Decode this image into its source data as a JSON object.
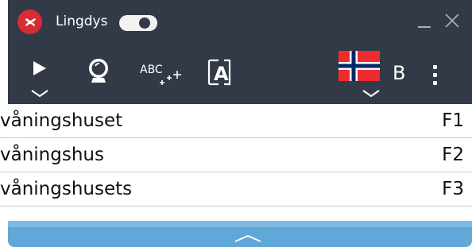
{
  "app": {
    "title": "Lingdys",
    "toggle_on": true
  },
  "colors": {
    "topbar": "#323a48",
    "accent": "#d62c36",
    "bottombar": "#5fa8d8"
  },
  "toolbar": {
    "icons": [
      "play-icon",
      "chevron-down-icon",
      "crystal-ball-icon",
      "spell-abc-sparkle-icon",
      "text-reader-icon",
      "norway-flag-icon",
      "chevron-down-icon",
      "more-vertical-icon"
    ],
    "language_letter": "B"
  },
  "suggestions": [
    {
      "word": "våningshuset",
      "key": "F1"
    },
    {
      "word": "våningshus",
      "key": "F2"
    },
    {
      "word": "våningshusets",
      "key": "F3"
    }
  ]
}
